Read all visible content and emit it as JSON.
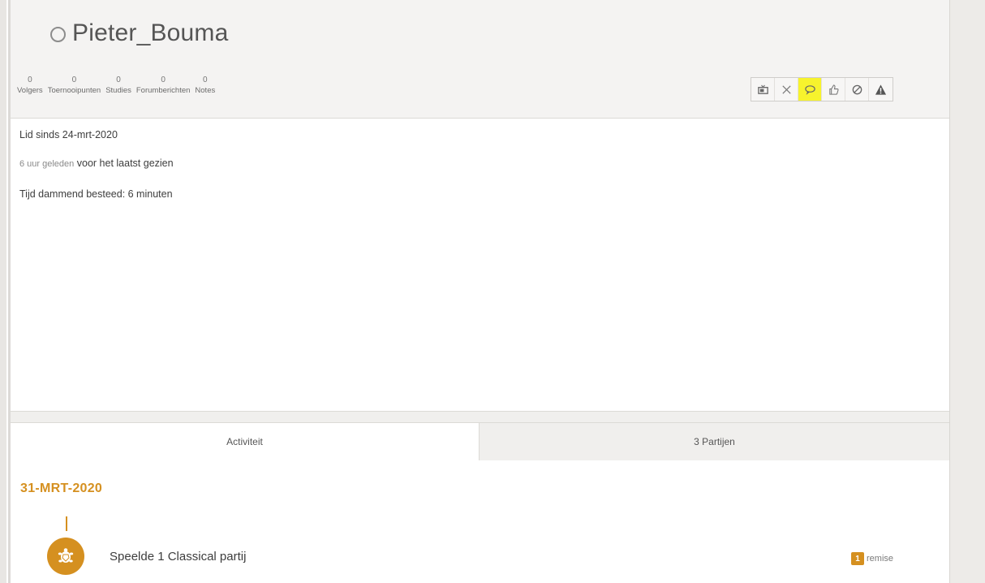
{
  "profile": {
    "username": "Pieter_Bouma",
    "stats": [
      {
        "count": "0",
        "label": "Volgers"
      },
      {
        "count": "0",
        "label": "Toernooipunten"
      },
      {
        "count": "0",
        "label": "Studies"
      },
      {
        "count": "0",
        "label": "Forumberichten"
      },
      {
        "count": "0",
        "label": "Notes"
      }
    ],
    "actions": [
      {
        "icon": "tv-icon"
      },
      {
        "icon": "swords-icon"
      },
      {
        "icon": "chat-bubble-icon",
        "highlighted": true
      },
      {
        "icon": "thumbs-up-icon"
      },
      {
        "icon": "block-icon"
      },
      {
        "icon": "warning-icon"
      }
    ]
  },
  "info": {
    "member_since": "Lid sinds 24-mrt-2020",
    "last_seen_time": "6 uur geleden",
    "last_seen_suffix": "voor het laatst gezien",
    "time_spent": "Tijd dammend besteed: 6 minuten"
  },
  "tabs": {
    "activity": "Activiteit",
    "games": "3 Partijen"
  },
  "activity": {
    "date": "31-MRT-2020",
    "entry_text": "Speelde 1 Classical partij",
    "result_count": "1",
    "result_label": "remise"
  },
  "colors": {
    "accent": "#d59020",
    "highlight": "#f7f32d",
    "header_bg": "#f4f3f2"
  }
}
